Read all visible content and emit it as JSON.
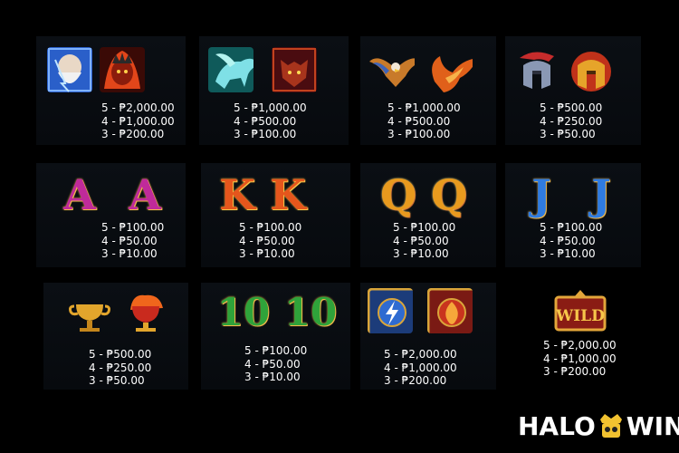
{
  "paytable": {
    "row1": [
      {
        "symbols": [
          "zeus-icon",
          "hades-icon"
        ],
        "pays": [
          "5 - ₱2,000.00",
          "4 - ₱1,000.00",
          "3 - ₱200.00"
        ]
      },
      {
        "symbols": [
          "pegasus-icon",
          "wolf-icon"
        ],
        "pays": [
          "5 - ₱1,000.00",
          "4 - ₱500.00",
          "3 - ₱100.00"
        ]
      },
      {
        "symbols": [
          "eagle-icon",
          "phoenix-icon"
        ],
        "pays": [
          "5 - ₱1,000.00",
          "4 - ₱500.00",
          "3 - ₱100.00"
        ]
      },
      {
        "symbols": [
          "blue-helmet-icon",
          "gold-helmet-icon"
        ],
        "pays": [
          "5 - ₱500.00",
          "4 - ₱250.00",
          "3 - ₱50.00"
        ]
      }
    ],
    "row2": [
      {
        "letters": [
          "A",
          "A"
        ],
        "pays": [
          "5 - ₱100.00",
          "4 - ₱50.00",
          "3 - ₱10.00"
        ]
      },
      {
        "letters": [
          "K",
          "K"
        ],
        "pays": [
          "5 - ₱100.00",
          "4 - ₱50.00",
          "3 - ₱10.00"
        ]
      },
      {
        "letters": [
          "Q",
          "Q"
        ],
        "pays": [
          "5 - ₱100.00",
          "4 - ₱50.00",
          "3 - ₱10.00"
        ]
      },
      {
        "letters": [
          "J",
          "J"
        ],
        "pays": [
          "5 - ₱100.00",
          "4 - ₱50.00",
          "3 - ₱10.00"
        ]
      }
    ],
    "row3": [
      {
        "symbols": [
          "gold-chalice-icon",
          "fire-chalice-icon"
        ],
        "pays": [
          "5 - ₱500.00",
          "4 - ₱250.00",
          "3 - ₱50.00"
        ]
      },
      {
        "letters": [
          "10",
          "10"
        ],
        "pays": [
          "5 - ₱100.00",
          "4 - ₱50.00",
          "3 - ₱10.00"
        ]
      },
      {
        "symbols": [
          "lightning-emblem-icon",
          "fire-emblem-icon"
        ],
        "pays": [
          "5 - ₱2,000.00",
          "4 - ₱1,000.00",
          "3 - ₱200.00"
        ]
      },
      {
        "symbols": [
          "wild-icon"
        ],
        "wild_text": "WILD",
        "pays": [
          "5 - ₱2,000.00",
          "4 - ₱1,000.00",
          "3 - ₱200.00"
        ]
      }
    ]
  },
  "logo": {
    "left": "HALO",
    "right": "WIN"
  },
  "colors": {
    "A": "#c02a9a",
    "K": "#e5561c",
    "Q": "#e89a1e",
    "J": "#2f7be0",
    "10": "#2fa33a"
  }
}
